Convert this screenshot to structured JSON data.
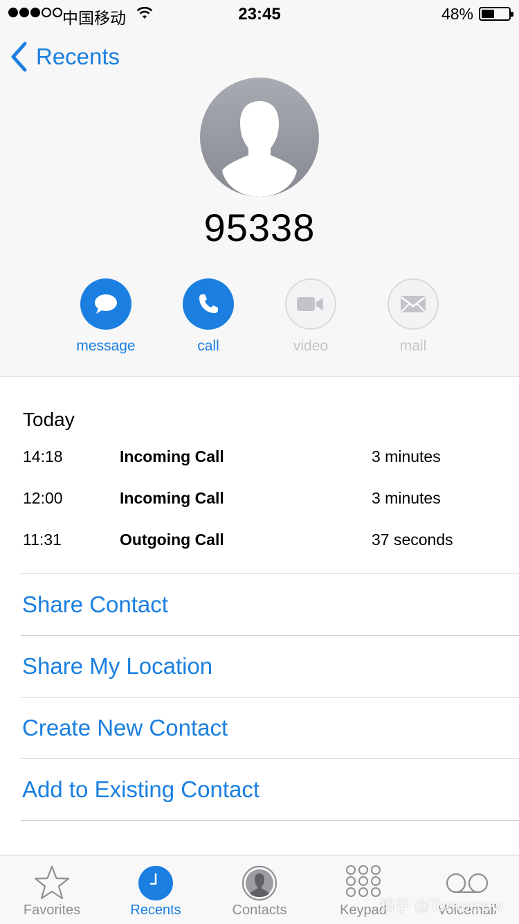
{
  "status_bar": {
    "carrier": "中国移动",
    "time": "23:45",
    "battery_percent": "48%",
    "battery_level": 0.48,
    "signal_bars_filled": 3,
    "signal_bars_total": 5
  },
  "nav": {
    "back_label": "Recents"
  },
  "contact": {
    "number": "95338"
  },
  "actions": [
    {
      "label": "message",
      "icon": "message-bubble-icon",
      "enabled": true
    },
    {
      "label": "call",
      "icon": "phone-icon",
      "enabled": true
    },
    {
      "label": "video",
      "icon": "video-camera-icon",
      "enabled": false
    },
    {
      "label": "mail",
      "icon": "envelope-icon",
      "enabled": false
    }
  ],
  "recents": {
    "title": "Today",
    "calls": [
      {
        "time": "14:18",
        "type": "Incoming Call",
        "duration": "3 minutes"
      },
      {
        "time": "12:00",
        "type": "Incoming Call",
        "duration": "3 minutes"
      },
      {
        "time": "11:31",
        "type": "Outgoing Call",
        "duration": "37 seconds"
      }
    ]
  },
  "options": [
    "Share Contact",
    "Share My Location",
    "Create New Contact",
    "Add to Existing Contact"
  ],
  "tab_bar": {
    "tabs": [
      {
        "label": "Favorites",
        "icon": "star-icon"
      },
      {
        "label": "Recents",
        "icon": "clock-icon"
      },
      {
        "label": "Contacts",
        "icon": "person-circle-icon"
      },
      {
        "label": "Keypad",
        "icon": "keypad-icon"
      },
      {
        "label": "Voicemail",
        "icon": "voicemail-icon"
      }
    ],
    "selected": "Recents"
  },
  "watermark": "知乎 @Tomorrow",
  "colors": {
    "accent": "#1a7fe0",
    "inactive": "#c3c3c8",
    "tab_inactive": "#8e8e93",
    "header_bg": "#f7f7f8"
  }
}
